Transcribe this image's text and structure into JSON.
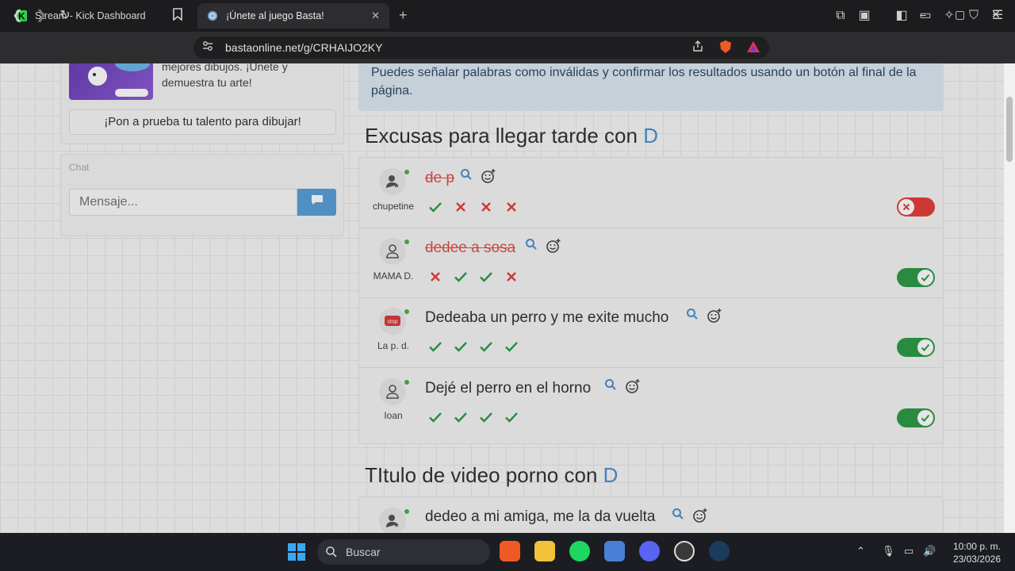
{
  "browser": {
    "tabs": [
      {
        "title": "Stream - Kick Dashboard"
      },
      {
        "title": "¡Únete al juego Basta!"
      }
    ],
    "url": "bastaonline.net/g/CRHAIJO2KY",
    "new_tab": "+",
    "window_controls": [
      "–",
      "▢",
      "✕"
    ]
  },
  "sidebar": {
    "promo_text": "mejores dibujos. ¡Únete y demuestra tu arte!",
    "promo_button": "¡Pon a prueba tu talento para dibujar!",
    "chat_label": "Chat",
    "chat_placeholder": "Mensaje..."
  },
  "main": {
    "info_text": "Puedes señalar palabras como inválidas y confirmar los resultados usando un botón al final de la página.",
    "categories": [
      {
        "title": "Excusas para llegar tarde con ",
        "letter": "D",
        "answers": [
          {
            "user": "chupetine",
            "text": "de p",
            "invalid": true,
            "votes": [
              "check",
              "x",
              "x",
              "x"
            ],
            "toggle": "off"
          },
          {
            "user": "MAMA D.",
            "text": "dedee a sosa",
            "invalid": true,
            "votes": [
              "x",
              "check",
              "check",
              "x"
            ],
            "toggle": "on"
          },
          {
            "user": "La p. d.",
            "text": "Dedeaba un perro y me exite mucho",
            "invalid": false,
            "votes": [
              "check",
              "check",
              "check",
              "check"
            ],
            "toggle": "on"
          },
          {
            "user": "Ioan",
            "text": "Dejé el perro en el horno",
            "invalid": false,
            "votes": [
              "check",
              "check",
              "check",
              "check"
            ],
            "toggle": "on"
          }
        ]
      },
      {
        "title": "TItulo de video porno con ",
        "letter": "D",
        "answers": [
          {
            "user": "",
            "text": "dedeo a mi amiga, me la da vuelta",
            "invalid": false
          }
        ]
      }
    ],
    "avatar_badge": "stop"
  },
  "taskbar": {
    "search_placeholder": "Buscar",
    "time": "10:00 p. m.",
    "date": "23/03/2026"
  },
  "colors": {
    "valid": "#2e9b48",
    "invalid": "#e4403c",
    "accent": "#4a90d0"
  }
}
